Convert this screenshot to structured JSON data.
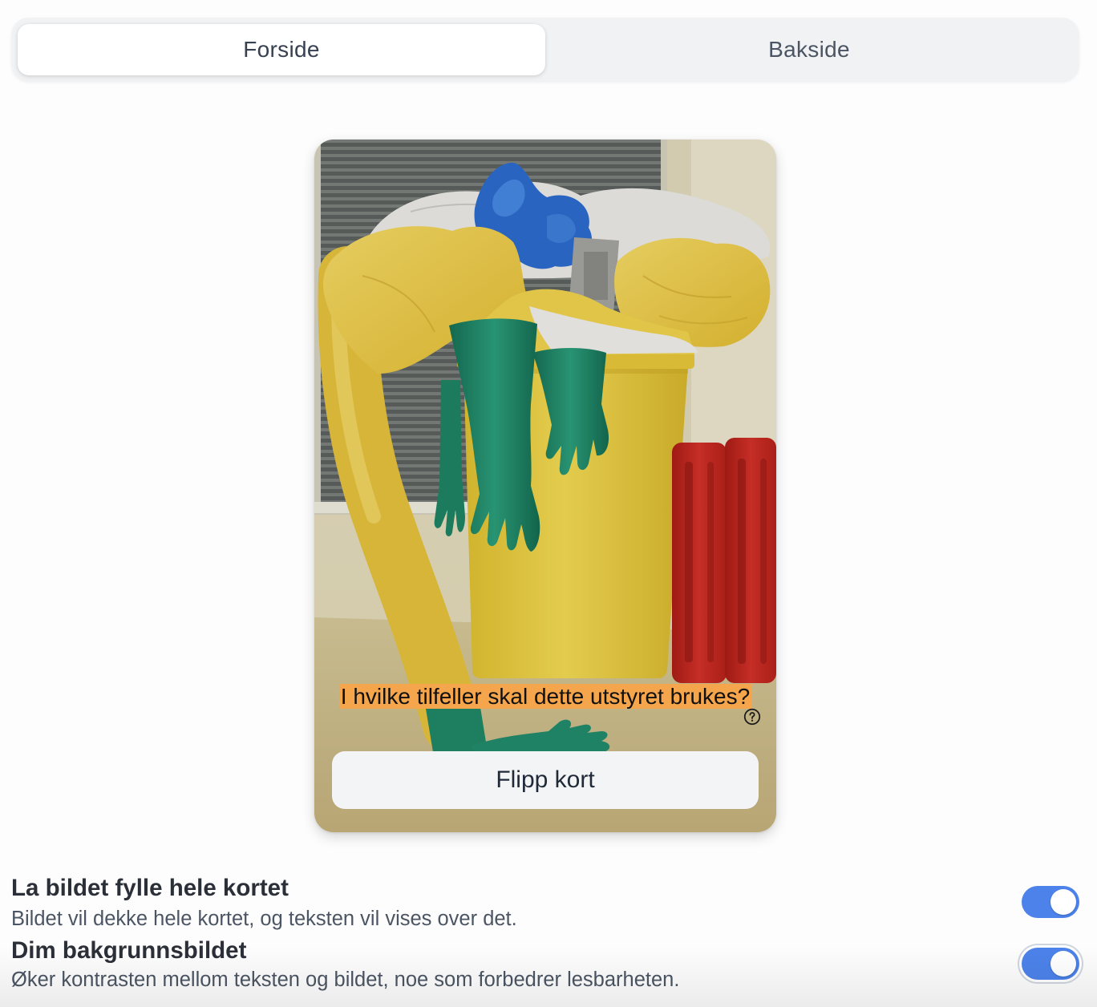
{
  "tabs": [
    {
      "label": "Forside",
      "active": true
    },
    {
      "label": "Bakside",
      "active": false
    }
  ],
  "card": {
    "question": "I hvilke tilfeller skal dette utstyret brukes?",
    "help_icon": "question-circle-icon",
    "flip_button_label": "Flipp kort",
    "highlight_color": "#f5a54c"
  },
  "settings": [
    {
      "title": "La bildet fylle hele kortet",
      "description": "Bildet vil dekke hele kortet, og teksten vil vises over det.",
      "enabled": true
    },
    {
      "title": "Dim bakgrunnsbildet",
      "description": "Øker kontrasten mellom teksten og bildet, noe som forbedrer lesbarheten.",
      "enabled": true
    }
  ],
  "colors": {
    "accent": "#4c82ea",
    "tab_track": "#f1f2f4",
    "button_bg": "#f3f4f6"
  }
}
